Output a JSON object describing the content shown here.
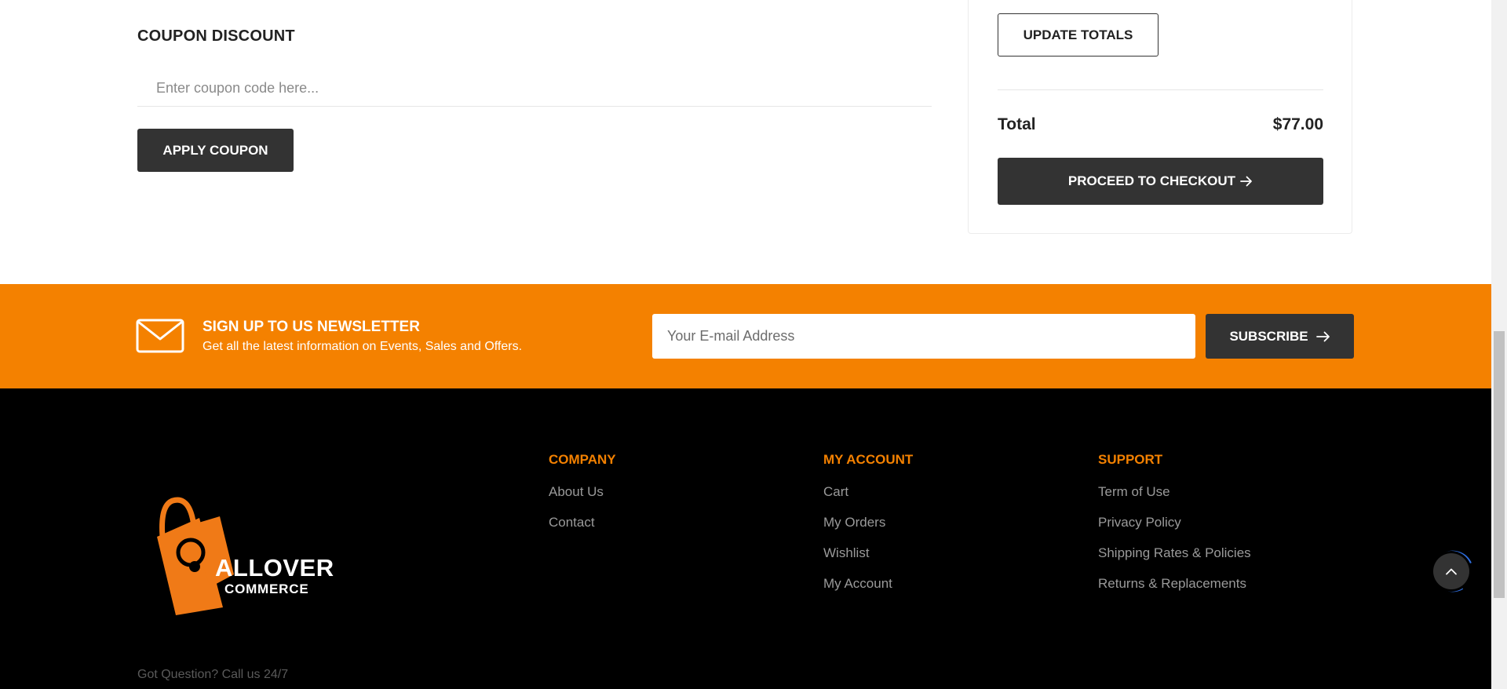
{
  "coupon": {
    "title": "COUPON DISCOUNT",
    "placeholder": "Enter coupon code here...",
    "apply_label": "APPLY COUPON"
  },
  "totals": {
    "update_label": "UPDATE TOTALS",
    "total_label": "Total",
    "total_value": "$77.00",
    "checkout_label": "PROCEED TO CHECKOUT"
  },
  "newsletter": {
    "title": "SIGN UP TO US NEWSLETTER",
    "subtitle": "Get all the latest information on Events, Sales and Offers.",
    "email_placeholder": "Your E-mail Address",
    "subscribe_label": "SUBSCRIBE"
  },
  "footer": {
    "logo": {
      "line1": "ALLOVER",
      "line2": "COMMERCE"
    },
    "columns": [
      {
        "title": "COMPANY",
        "links": [
          "About Us",
          "Contact"
        ]
      },
      {
        "title": "MY ACCOUNT",
        "links": [
          "Cart",
          "My Orders",
          "Wishlist",
          "My Account"
        ]
      },
      {
        "title": "SUPPORT",
        "links": [
          "Term of Use",
          "Privacy Policy",
          "Shipping Rates & Policies",
          "Returns & Replacements"
        ]
      }
    ],
    "got_question": "Got Question? Call us 24/7"
  },
  "colors": {
    "accent": "#f48100",
    "dark_button": "#333333",
    "footer_bg": "#000000",
    "link": "#9a9a9a"
  },
  "icons": {
    "newsletter": "envelope-icon",
    "arrow": "arrow-right-icon",
    "back_to_top": "chevron-up-icon"
  }
}
